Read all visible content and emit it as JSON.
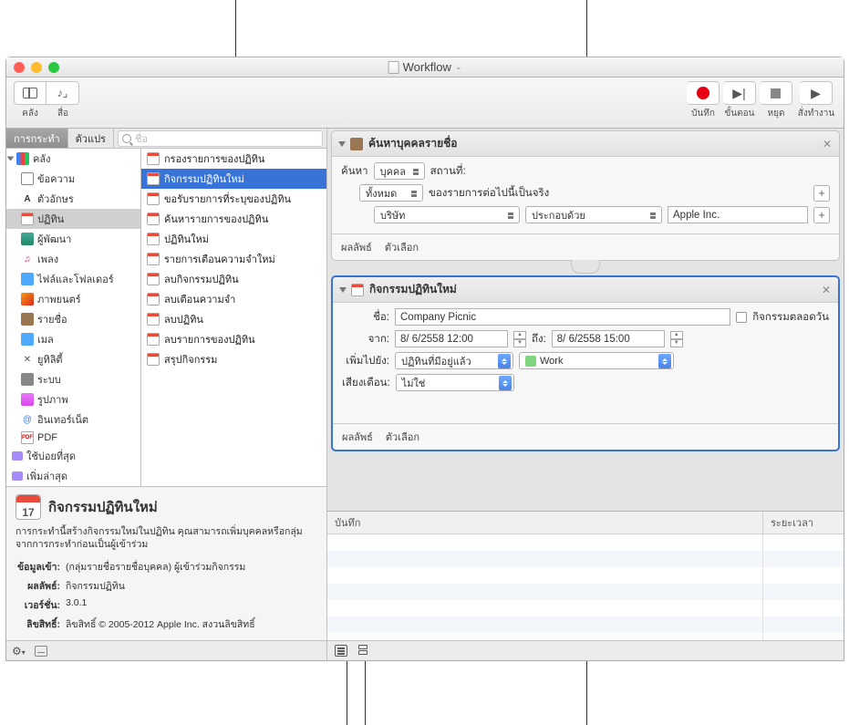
{
  "titlebar": {
    "title": "Workflow"
  },
  "toolbar": {
    "lib_label": "คลัง",
    "media_label": "สื่อ",
    "record_label": "บันทึก",
    "step_label": "ขั้นตอน",
    "stop_label": "หยุด",
    "run_label": "สั่งทำงาน"
  },
  "tabs": {
    "actions": "การกระทำ",
    "variables": "ตัวแปร"
  },
  "search": {
    "placeholder": "ชื่อ"
  },
  "library": {
    "header": "คลัง",
    "items": [
      "ข้อความ",
      "ตัวอักษร",
      "ปฏิทิน",
      "ผู้พัฒนา",
      "เพลง",
      "ไฟล์และโฟลเดอร์",
      "ภาพยนตร์",
      "รายชื่อ",
      "เมล",
      "ยูทิลิตี้",
      "ระบบ",
      "รูปภาพ",
      "อินเทอร์เน็ต",
      "PDF"
    ],
    "most_used": "ใช้บ่อยที่สุด",
    "recent": "เพิ่มล่าสุด"
  },
  "actions_list": [
    "กรองรายการของปฏิทิน",
    "กิจกรรมปฏิทินใหม่",
    "ขอรับรายการที่ระบุของปฏิทิน",
    "ค้นหารายการของปฏิทิน",
    "ปฏิทินใหม่",
    "รายการเตือนความจำใหม่",
    "ลบกิจกรรมปฏิทิน",
    "ลบเตือนความจำ",
    "ลบปฏิทิน",
    "ลบรายการของปฏิทิน",
    "สรุปกิจกรรม"
  ],
  "info": {
    "title": "กิจกรรมปฏิทินใหม่",
    "desc": "การกระทำนี้สร้างกิจกรรมใหม่ในปฏิทิน คุณสามารถเพิ่มบุคคลหรือกลุ่มจากการกระทำก่อนเป็นผู้เข้าร่วม",
    "rows": {
      "input_label": "ข้อมูลเข้า:",
      "input_val": "(กลุ่มรายชื่อรายชื่อบุคคล) ผู้เข้าร่วมกิจกรรม",
      "output_label": "ผลลัพธ์:",
      "output_val": "กิจกรรมปฏิทิน",
      "version_label": "เวอร์ชั่น:",
      "version_val": "3.0.1",
      "copyright_label": "ลิขสิทธิ์:",
      "copyright_val": "ลิขสิทธิ์ © 2005-2012 Apple Inc.  สงวนลิขสิทธิ์"
    }
  },
  "workflow": {
    "a1": {
      "title": "ค้นหาบุคคลรายชื่อ",
      "find_label": "ค้นหา",
      "find_val": "บุคคล",
      "where_label": "สถานที่:",
      "scope": "ทั้งหมด",
      "following_true": "ของรายการต่อไปนี้เป็นจริง",
      "field": "บริษัท",
      "op": "ประกอบด้วย",
      "value": "Apple Inc.",
      "results": "ผลลัพธ์",
      "options": "ตัวเลือก"
    },
    "a2": {
      "title": "กิจกรรมปฏิทินใหม่",
      "name_label": "ชื่อ:",
      "name_val": "Company Picnic",
      "allday": "กิจกรรมตลอดวัน",
      "from_label": "จาก:",
      "from_val": "8/ 6/2558  12:00",
      "to_label": "ถึง:",
      "to_val": "8/ 6/2558  15:00",
      "addto_label": "เพิ่มไปยัง:",
      "addto_val": "ปฏิทินที่มีอยู่แล้ว",
      "calendar": "Work",
      "alarm_label": "เสียงเตือน:",
      "alarm_val": "ไม่ใช่",
      "results": "ผลลัพธ์",
      "options": "ตัวเลือก"
    }
  },
  "log": {
    "col1": "บันทึก",
    "col2": "ระยะเวลา"
  }
}
